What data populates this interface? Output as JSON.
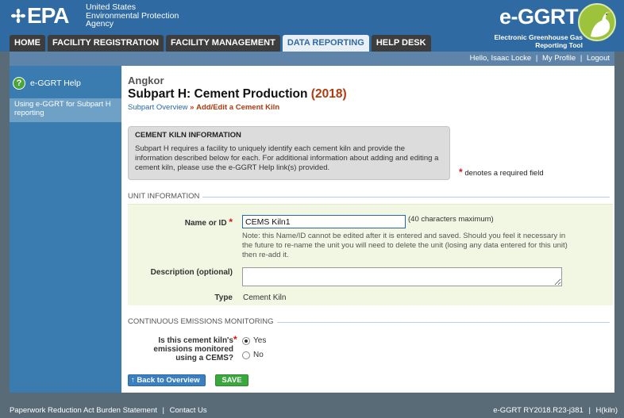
{
  "header": {
    "epa_word": "EPA",
    "epa_line1": "United States",
    "epa_line2": "Environmental Protection",
    "epa_line3": "Agency",
    "app_title": "e-GGRT",
    "app_sub1": "Electronic Greenhouse Gas",
    "app_sub2": "Reporting Tool"
  },
  "nav": {
    "tabs": [
      {
        "label": "HOME"
      },
      {
        "label": "FACILITY REGISTRATION"
      },
      {
        "label": "FACILITY MANAGEMENT"
      },
      {
        "label": "DATA REPORTING",
        "active": true
      },
      {
        "label": "HELP DESK"
      }
    ]
  },
  "userbar": {
    "greeting": "Hello, Isaac Locke",
    "my_profile": "My Profile",
    "logout": "Logout"
  },
  "sidebar": {
    "help_title": "e-GGRT Help",
    "help_link": "Using e-GGRT for Subpart H reporting"
  },
  "main": {
    "facility": "Angkor",
    "title": "Subpart H: Cement Production",
    "year": "(2018)",
    "breadcrumb_link": "Subpart Overview",
    "breadcrumb_sep": "»",
    "breadcrumb_current": "Add/Edit a Cement Kiln",
    "info_title": "CEMENT KILN INFORMATION",
    "info_text": "Subpart H requires a facility to uniquely identify each cement kiln and provide the information described below for each. For additional information about adding and editing a cement kiln, please use the e-GGRT Help link(s) provided.",
    "required_note": "denotes a required field",
    "unit_section": "UNIT INFORMATION",
    "name_label": "Name or ID",
    "name_value": "CEMS Kiln1",
    "name_max": "(40 characters maximum)",
    "name_note": "Note: this Name/ID cannot be edited after it is entered and saved. Should you feel it necessary in the future to re-name the unit you will need to delete the unit (losing any data entered for this unit) then re-add it.",
    "desc_label": "Description (optional)",
    "desc_value": "",
    "type_label": "Type",
    "type_value": "Cement Kiln",
    "cems_section": "CONTINUOUS EMISSIONS MONITORING",
    "cems_question": "Is this cement kiln's emissions monitored using a CEMS?",
    "cems_yes": "Yes",
    "cems_no": "No",
    "cems_selected": "Yes",
    "back_button": "Back to Overview",
    "save_button": "SAVE"
  },
  "footer": {
    "paperwork": "Paperwork Reduction Act Burden Statement",
    "contact": "Contact Us",
    "version": "e-GGRT RY2018.R23-j381",
    "page_code": "H(kiln)"
  },
  "colors": {
    "header_blue": "#2f6aa3",
    "active_tab": "#e8f0f6",
    "sidebar": "#3a7caf",
    "title_accent": "#b13a0e",
    "save_green": "#3aa83e",
    "back_blue": "#3a7fc1"
  }
}
